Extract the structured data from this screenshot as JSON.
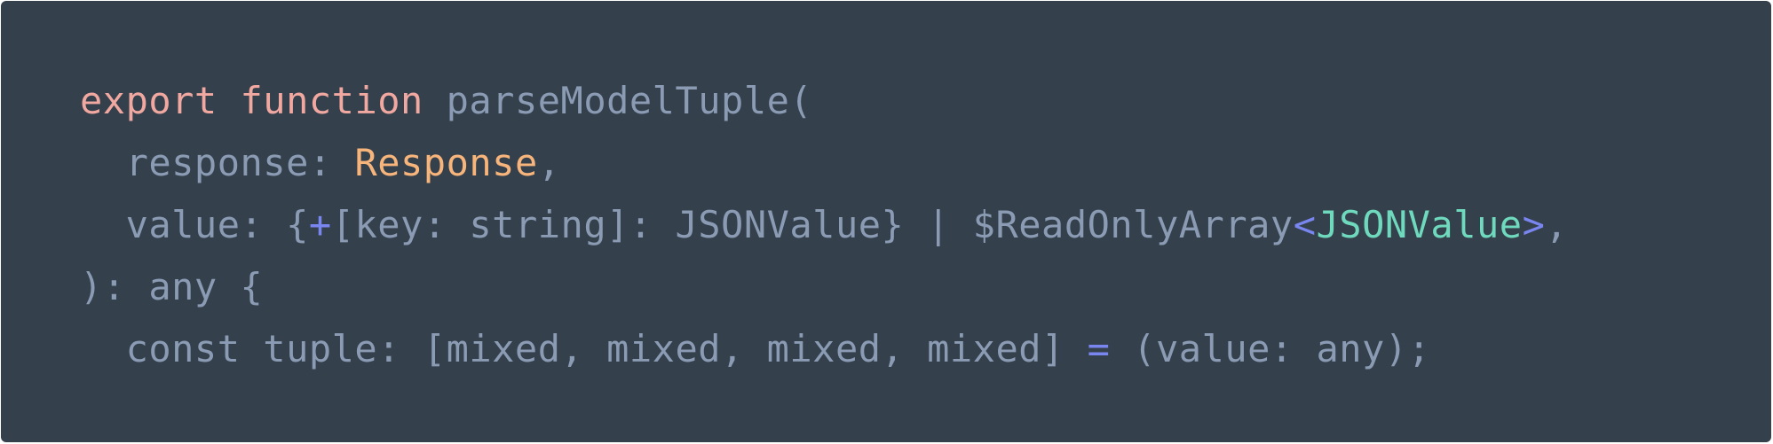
{
  "colors": {
    "background": "#35404d",
    "plain": "#8a9bb3",
    "keyword": "#f0a8a0",
    "type": "#f7b57c",
    "operator": "#7a86f0",
    "generic_type": "#6fd9bd"
  },
  "code": {
    "lines": [
      {
        "tokens": [
          {
            "text": "export",
            "kind": "keyword"
          },
          {
            "text": " ",
            "kind": "plain"
          },
          {
            "text": "function",
            "kind": "keyword"
          },
          {
            "text": " parseModelTuple(",
            "kind": "plain"
          }
        ]
      },
      {
        "tokens": [
          {
            "text": "  response: ",
            "kind": "plain"
          },
          {
            "text": "Response",
            "kind": "type"
          },
          {
            "text": ",",
            "kind": "plain"
          }
        ]
      },
      {
        "tokens": [
          {
            "text": "  value: {",
            "kind": "plain"
          },
          {
            "text": "+",
            "kind": "operator"
          },
          {
            "text": "[key: string]: JSONValue} | $ReadOnlyArray",
            "kind": "plain"
          },
          {
            "text": "<",
            "kind": "operator"
          },
          {
            "text": "JSONValue",
            "kind": "generic_type"
          },
          {
            "text": ">",
            "kind": "operator"
          },
          {
            "text": ",",
            "kind": "plain"
          }
        ]
      },
      {
        "tokens": [
          {
            "text": "): any {",
            "kind": "plain"
          }
        ]
      },
      {
        "tokens": [
          {
            "text": "  const tuple: [mixed, mixed, mixed, mixed] ",
            "kind": "plain"
          },
          {
            "text": "=",
            "kind": "operator"
          },
          {
            "text": " (value: any);",
            "kind": "plain"
          }
        ]
      }
    ]
  }
}
